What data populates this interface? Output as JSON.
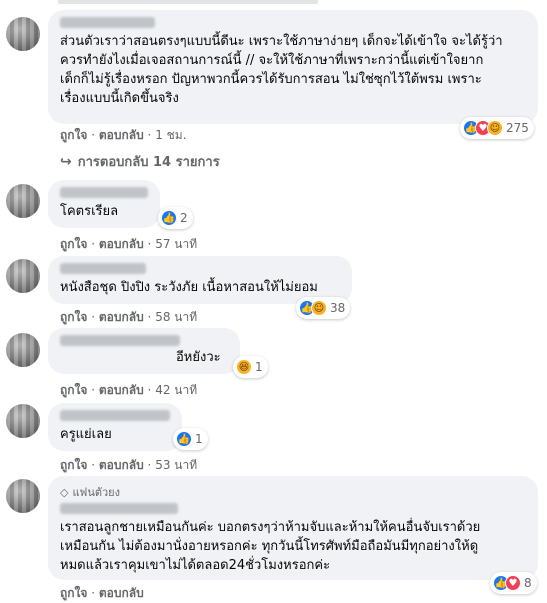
{
  "comments": [
    {
      "text": "ส่วนตัวเราว่าสอนตรงๆแบบนี้ดีนะ เพราะใช้ภาษาง่ายๆ เด็กจะได้เข้าใจ จะได้รู้ว่า\nควรทำยังไงเมื่อเจอสถานการณ์นี้ // จะให้ใช้ภาษาที่เพราะกว่านี้แต่เข้าใจยาก\nเด็กก็ไม่รู้เรื่องหรอก ปัญหาพวกนี้ควรได้รับการสอน ไม่ใช่ซุกไว้ใต้พรม เพราะ\nเรื่องแบบนี้เกิดขึ้นจริง",
      "like": "ถูกใจ",
      "reply": "ตอบกลับ",
      "time": "1 ชม.",
      "reaction_icons": [
        "like-icon",
        "love-icon",
        "care-icon"
      ],
      "reaction_count": "275"
    },
    {
      "text": "โคตรเรียล",
      "like": "ถูกใจ",
      "reply": "ตอบกลับ",
      "time": "57 นาที",
      "reaction_icons": [
        "like-icon"
      ],
      "reaction_count": "2"
    },
    {
      "text": "หนังสือชุด ปิงปิง ระวังภัย เนื้อหาสอนให้ไม่ยอม",
      "like": "ถูกใจ",
      "reply": "ตอบกลับ",
      "time": "58 นาที",
      "reaction_icons": [
        "like-icon",
        "care-icon"
      ],
      "reaction_count": "38"
    },
    {
      "text": "อีหยังวะ",
      "like": "ถูกใจ",
      "reply": "ตอบกลับ",
      "time": "42 นาที",
      "reaction_icons": [
        "haha-icon"
      ],
      "reaction_count": "1"
    },
    {
      "text": "ครูแย่เลย",
      "like": "ถูกใจ",
      "reply": "ตอบกลับ",
      "time": "53 นาที",
      "reaction_icons": [
        "like-icon"
      ],
      "reaction_count": "1"
    },
    {
      "badge": "แฟนตัวยง",
      "text": "เราสอนลูกชายเหมือนกันค่ะ บอกตรงๆว่าห้ามจับและห้ามให้คนอื่นจับเราด้วย\nเหมือนกัน ไม่ต้องมานั่งอายหรอกค่ะ ทุกวันนี้โทรศัพท์มือถือมันมีทุกอย่างให้ดู\nหมดแล้วเราคุมเขาไม่ได้ตลอด24ชั่วโมงหรอกค่ะ",
      "like": "ถูกใจ",
      "reply": "ตอบกลับ",
      "time": "",
      "reaction_icons": [
        "like-icon",
        "love-icon"
      ],
      "reaction_count": "8"
    }
  ],
  "replies_toggle": "การตอบกลับ 14 รายการ",
  "colors": {
    "bubble": "#f0f2f5",
    "meta": "#65676b",
    "like": "#1877f2",
    "love": "#f33e58",
    "care": "#f7b125"
  }
}
